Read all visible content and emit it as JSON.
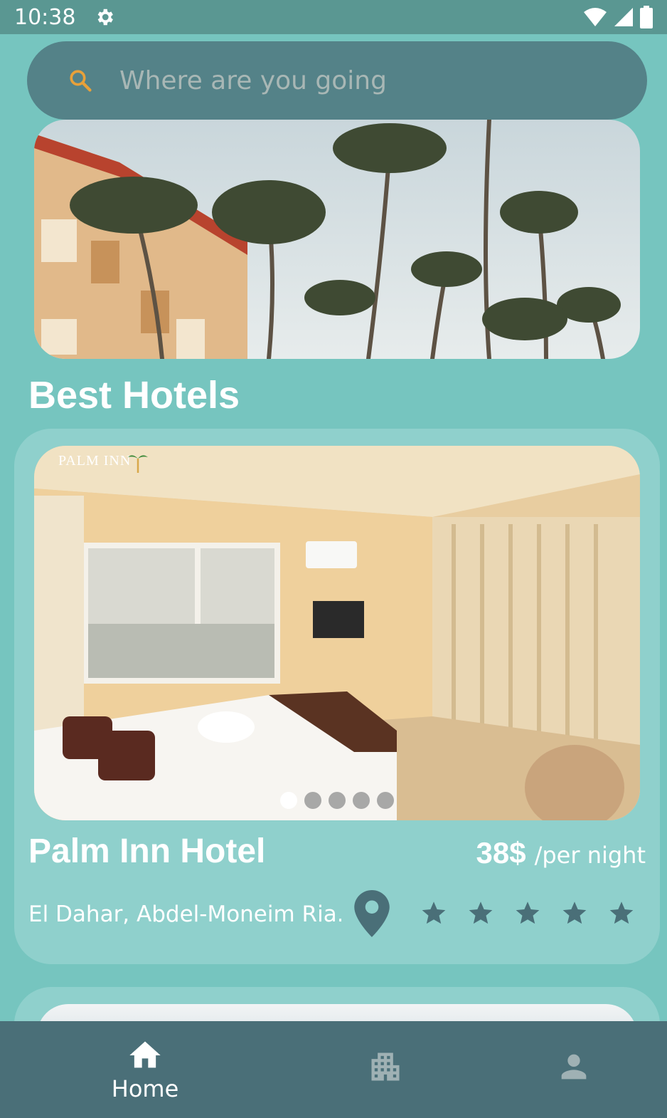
{
  "status_bar": {
    "time": "10:38",
    "icons": [
      "gear-icon",
      "wifi-icon",
      "signal-icon",
      "battery-icon"
    ]
  },
  "search": {
    "placeholder": "Where are you going",
    "icon": "search-icon",
    "icon_color": "#e8a13a"
  },
  "banner": {
    "image": "palm-trees-resort-photo"
  },
  "section_title": "Best Hotels",
  "hotels": [
    {
      "name": "Palm Inn Hotel",
      "price": "38$",
      "price_unit": "/per night",
      "address": "El Dahar, Abdel-Moneim Ria...",
      "photo_logo": "PALM INN",
      "photo_count": 5,
      "active_photo_index": 0,
      "rating": 5
    }
  ],
  "bottom_nav": {
    "items": [
      {
        "label": "Home",
        "icon": "home-icon",
        "active": true
      },
      {
        "label": "",
        "icon": "hotel-building-icon",
        "active": false
      },
      {
        "label": "",
        "icon": "person-icon",
        "active": false
      }
    ]
  },
  "colors": {
    "background": "#76c5bf",
    "status_bar": "#5a9792",
    "search_bar": "#548288",
    "card": "#8fd0cc",
    "icon_dark": "#4a6f78",
    "bottom_nav": "#4a6f78"
  }
}
